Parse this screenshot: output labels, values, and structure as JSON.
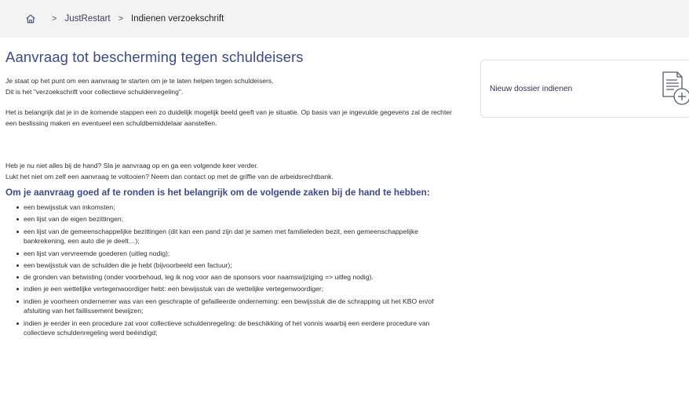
{
  "breadcrumb": {
    "items": [
      "JustRestart",
      "Indienen verzoekschrift"
    ],
    "separator": ">"
  },
  "main": {
    "title": "Aanvraag tot bescherming tegen schuldeiser",
    "title_full": "Aanvraag tot bescherming tegen schuldeisers",
    "intro_line1": "Je staat op het punt om een aanvraag te starten om je te laten helpen tegen schuldeisers.",
    "intro_line2": "Dit is het \"verzoekschrift voor collectieve schuldenregeling\".",
    "importance": "Het is belangrijk dat je in de komende stappen een zo duidelijk mogelijk beeld geeft van je situatie. Op basis van je ingevulde gegevens zal de rechter een beslissing maken en eventueel een schuldbemiddelaar aanstellen.",
    "save_line": "Heb je nu niet alles bij de hand? Sla je aanvraag op en ga een volgende keer verder.",
    "contact_line": "Lukt het niet om zelf een aanvraag te voltooien? Neem dan contact op met de griffie van de arbeidsrechtbank.",
    "list_heading": "Om je aanvraag goed af te ronden is het belangrijk om de volgende zaken bij de hand te hebben:",
    "list_items": [
      "een bewijsstuk van inkomsten;",
      "een lijst van de eigen bezittingen;",
      "een lijst van de gemeenschappelijke bezittingen (dit kan een pand zijn dat je samen met familieleden bezit, een gemeenschappelijke bankrekening, een auto die je deelt…);",
      "een lijst van vervreemde goederen (uitleg nodig);",
      "een bewijsstuk van de schulden die je hebt (bijvoorbeeld een factuur);",
      "de gronden van betwisting (onder voorbehoud, leg ik nog voor aan de sponsors voor naamswijziging => uitleg nodig).",
      "indien je een wettelijke vertegenwoordiger hebt: een bewijsstuk van de wettelijke vertegenwoordiger;",
      "indien je voorheen ondernemer was van een geschrapte of gefailleerde onderneming: een bewijsstuk die de schrapping uit het KBO en/of afsluiting van het faillissement bewijzen;",
      "indien je eerder in een procedure zat voor collectieve schuldenregeling: de beschikking of het vonnis waarbij een eerdere procedure van collectieve schuldenregeling werd beëindigd;"
    ]
  },
  "side_card": {
    "label": "Nieuw dossier indienen",
    "icon": "file-add-icon"
  },
  "colors": {
    "accent": "#3d4a8a",
    "breadcrumb_bg": "#f3f3f4",
    "card_border": "#e1e1e4"
  }
}
